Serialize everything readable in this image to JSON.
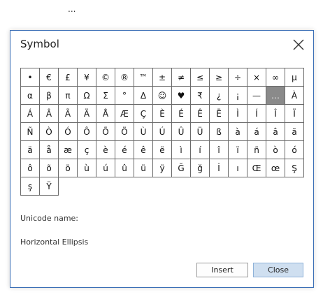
{
  "background": {
    "ellipsis_text": "..."
  },
  "dialog": {
    "title": "Symbol",
    "close_icon": "close-icon",
    "symbols": [
      "•",
      "€",
      "£",
      "¥",
      "©",
      "®",
      "™",
      "±",
      "≠",
      "≤",
      "≥",
      "÷",
      "×",
      "∞",
      "μ",
      "α",
      "β",
      "π",
      "Ω",
      "Σ",
      "°",
      "Δ",
      "☺",
      "♥",
      "₹",
      "¿",
      "¡",
      "—",
      "…",
      "À",
      "Á",
      "Â",
      "Ã",
      "Ä",
      "Å",
      "Æ",
      "Ç",
      "È",
      "É",
      "Ê",
      "Ë",
      "Ì",
      "Í",
      "Î",
      "Ï",
      "Ñ",
      "Ò",
      "Ó",
      "Ô",
      "Õ",
      "Ö",
      "Ù",
      "Ú",
      "Û",
      "Ü",
      "ß",
      "à",
      "á",
      "â",
      "ã",
      "ä",
      "å",
      "æ",
      "ç",
      "è",
      "é",
      "ê",
      "ë",
      "ì",
      "í",
      "î",
      "ï",
      "ñ",
      "ò",
      "ó",
      "ô",
      "õ",
      "ö",
      "ù",
      "ú",
      "û",
      "ü",
      "ÿ",
      "Ğ",
      "ğ",
      "İ",
      "ı",
      "Œ",
      "œ",
      "Ş",
      "ş",
      "Ÿ"
    ],
    "selected_index": 28,
    "unicode_name_label": "Unicode name:",
    "unicode_name_value": "Horizontal Ellipsis",
    "insert_label": "Insert",
    "close_label": "Close",
    "colors": {
      "border": "#3b6fb6",
      "selected_cell": "#8a8a8a",
      "primary_button": "#cfdff0"
    }
  }
}
